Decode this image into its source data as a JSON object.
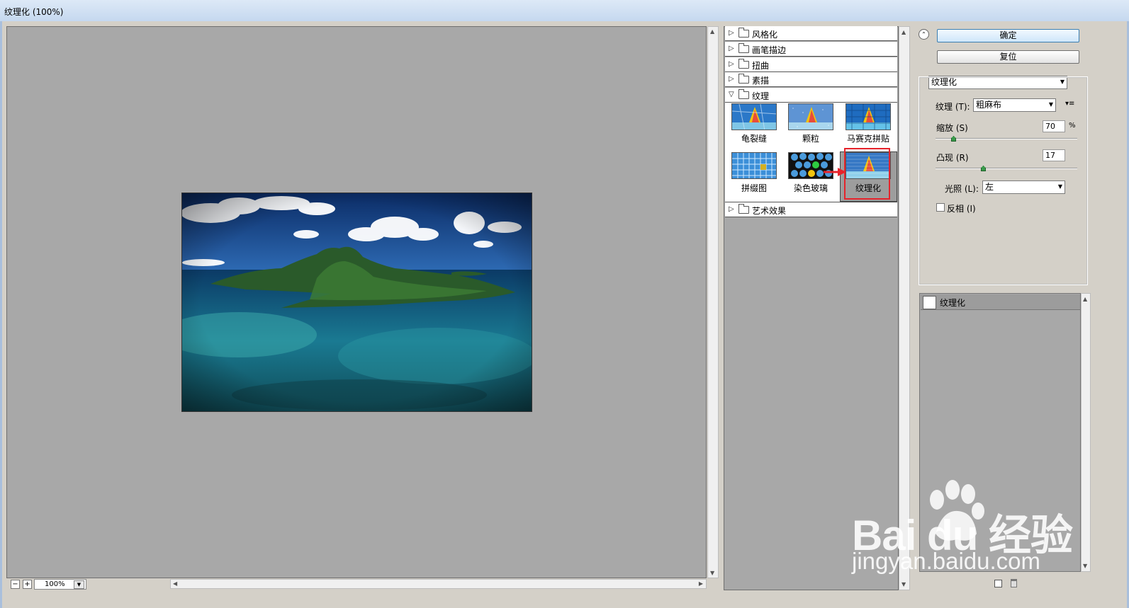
{
  "window": {
    "title": "纹理化 (100%)"
  },
  "preview": {
    "zoom_value": "100%",
    "zoom_out": "−",
    "zoom_in": "+",
    "image_alt": "island lake landscape"
  },
  "filter_tree": {
    "categories_top": [
      {
        "label": "风格化"
      },
      {
        "label": "画笔描边"
      },
      {
        "label": "扭曲"
      },
      {
        "label": "素描"
      }
    ],
    "expanded": {
      "label": "纹理",
      "items": [
        {
          "label": "龟裂缝"
        },
        {
          "label": "颗粒"
        },
        {
          "label": "马赛克拼贴"
        },
        {
          "label": "拼缀图"
        },
        {
          "label": "染色玻璃"
        },
        {
          "label": "纹理化",
          "selected": true
        }
      ]
    },
    "categories_bottom": [
      {
        "label": "艺术效果"
      }
    ]
  },
  "panel": {
    "ok_label": "确定",
    "reset_label": "复位",
    "filter_select": "纹理化",
    "texture_label": "纹理 (T):",
    "texture_value": "粗麻布",
    "scale_label": "缩放 (S)",
    "scale_value": "70",
    "scale_unit": "%",
    "scale_fraction": 0.13,
    "relief_label": "凸现 (R)",
    "relief_value": "17",
    "relief_fraction": 0.34,
    "light_label": "光照 (L):",
    "light_value": "左",
    "invert_label": "反相 (I)",
    "invert_checked": false
  },
  "layers": {
    "items": [
      {
        "label": "纹理化"
      }
    ]
  },
  "watermark": {
    "logo": "Bai du 经验",
    "url": "jingyan.baidu.com"
  },
  "colors": {
    "selection_red": "#e6232b",
    "panel_bg": "#d4d0c8",
    "canvas_gray": "#a8a8a8"
  }
}
